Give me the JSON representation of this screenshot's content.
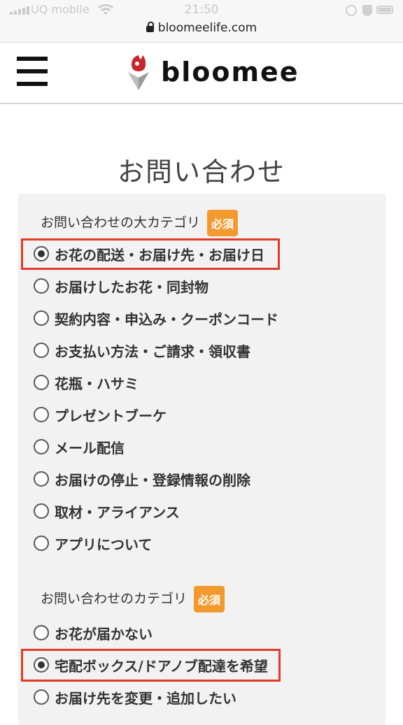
{
  "status_bar": {
    "carrier": "UQ mobile",
    "time": "21:50",
    "url": "bloomeelife.com"
  },
  "header": {
    "brand": "bloomee",
    "menu_icon": "hamburger-icon",
    "logo_icon": "flower-logo-icon"
  },
  "page_title": "お問い合わせ",
  "colors": {
    "badge": "#f39a2e",
    "highlight": "#e23a2b",
    "logo_red": "#c8262a"
  },
  "major_category": {
    "label": "お問い合わせの大カテゴリ",
    "required": "必須",
    "options": [
      {
        "label": "お花の配送・お届け先・お届け日",
        "checked": true
      },
      {
        "label": "お届けしたお花・同封物",
        "checked": false
      },
      {
        "label": "契約内容・申込み・クーポンコード",
        "checked": false
      },
      {
        "label": "お支払い方法・ご請求・領収書",
        "checked": false
      },
      {
        "label": "花瓶・ハサミ",
        "checked": false
      },
      {
        "label": "プレゼントブーケ",
        "checked": false
      },
      {
        "label": "メール配信",
        "checked": false
      },
      {
        "label": "お届けの停止・登録情報の削除",
        "checked": false
      },
      {
        "label": "取材・アライアンス",
        "checked": false
      },
      {
        "label": "アプリについて",
        "checked": false
      }
    ]
  },
  "category": {
    "label": "お問い合わせのカテゴリ",
    "required": "必須",
    "options": [
      {
        "label": "お花が届かない",
        "checked": false
      },
      {
        "label": "宅配ボックス/ドアノブ配達を希望",
        "checked": true
      },
      {
        "label": "お届け先を変更・追加したい",
        "checked": false
      }
    ]
  }
}
